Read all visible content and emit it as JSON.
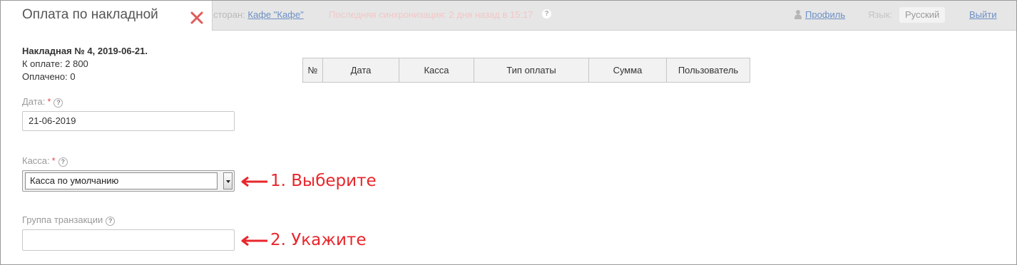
{
  "window": {
    "title": "Оплата по накладной",
    "close_icon": "close-icon"
  },
  "topbar": {
    "restaurant_label": "сторан:",
    "restaurant_link": "Кафе \"Кафе\"",
    "sync_text": "Последняя синхронизация: 2 дня назад в 15:17",
    "profile_link": "Профиль",
    "language_label": "Язык:",
    "language_value": "Русский",
    "logout_link": "Выйти"
  },
  "invoice": {
    "title": "Накладная № 4, 2019-06-21.",
    "to_pay": "К оплате: 2 800",
    "paid": "Оплачено: 0"
  },
  "form": {
    "date": {
      "label": "Дата:",
      "required_mark": "*",
      "value": "21-06-2019"
    },
    "cashbox": {
      "label": "Касса:",
      "required_mark": "*",
      "selected": "Касса по умолчанию"
    },
    "transaction_group": {
      "label": "Группа транзакции",
      "value": ""
    },
    "help_glyph": "?"
  },
  "annotations": {
    "step1": "1. Выберите",
    "step2": "2. Укажите",
    "color": "#e8262b"
  },
  "payments_table": {
    "columns": [
      "№",
      "Дата",
      "Касса",
      "Тип оплаты",
      "Сумма",
      "Пользователь"
    ],
    "rows": []
  },
  "colors": {
    "accent_red": "#e04b4b",
    "link_blue": "#6b8fc4",
    "topbar_bg": "#e6e6e6"
  }
}
